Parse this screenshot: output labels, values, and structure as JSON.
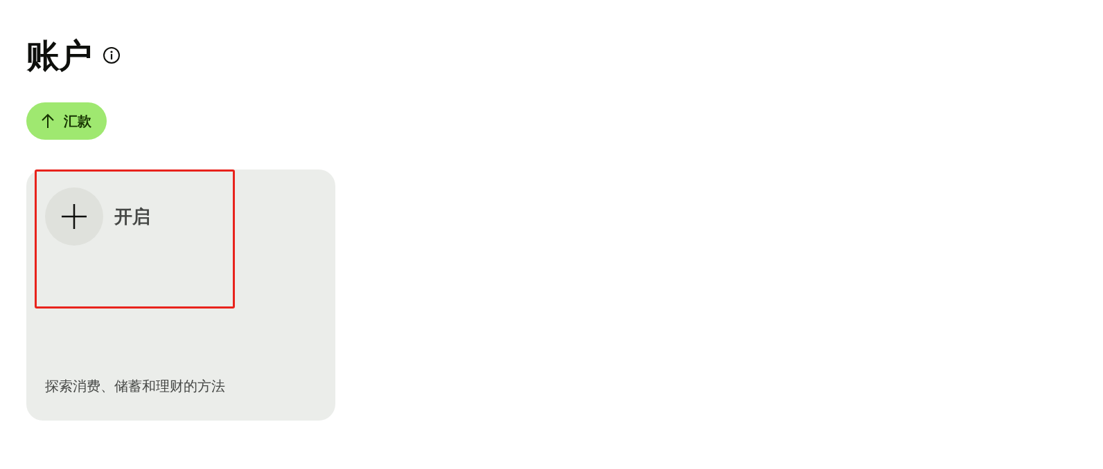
{
  "page": {
    "title": "账户"
  },
  "actions": [
    {
      "label": "汇款"
    }
  ],
  "account_card": {
    "open_label": "开启",
    "highlighted": true,
    "description": "探索消费、储蓄和理财的方法"
  }
}
